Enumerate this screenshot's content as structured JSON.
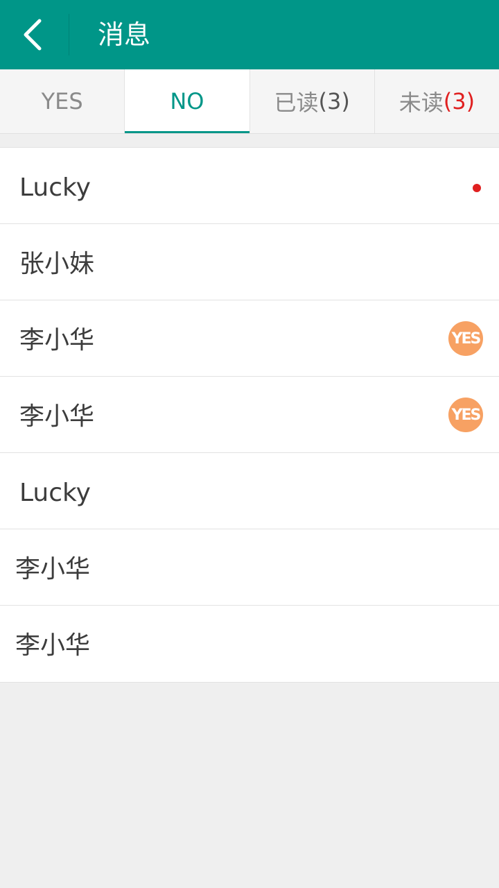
{
  "header": {
    "title": "消息",
    "back_icon": "chevron-left-icon"
  },
  "tabs": [
    {
      "label": "YES",
      "count": "",
      "active": false
    },
    {
      "label": "NO",
      "count": "",
      "active": true
    },
    {
      "label": "已读",
      "count": "(3)",
      "active": false
    },
    {
      "label": "未读",
      "count": "(3)",
      "active": false,
      "count_color": "#e02020"
    }
  ],
  "messages": [
    {
      "name": "Lucky",
      "indicator": "red-dot"
    },
    {
      "name": "张小妹",
      "indicator": ""
    },
    {
      "name": "李小华",
      "badge": "YES"
    },
    {
      "name": "李小华",
      "badge": "YES"
    },
    {
      "name": "Lucky",
      "indicator": ""
    },
    {
      "name": "李小华",
      "indicator": ""
    },
    {
      "name": "李小华",
      "indicator": ""
    }
  ],
  "colors": {
    "primary": "#009688",
    "badge": "#f7a163",
    "unread_dot": "#e02020"
  }
}
